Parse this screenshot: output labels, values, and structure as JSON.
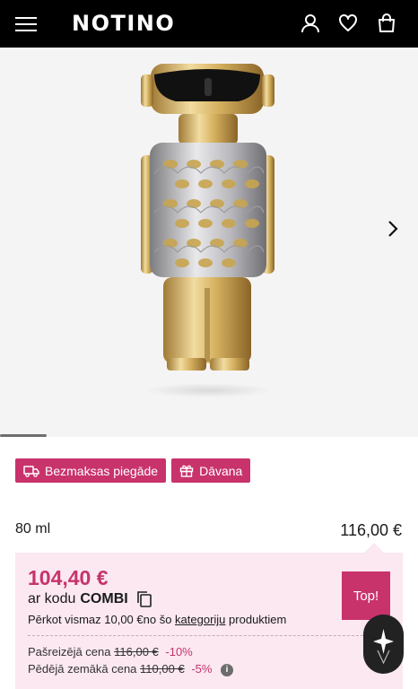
{
  "header": {
    "logo": "NOTINO",
    "icons": [
      "menu-icon",
      "user-icon",
      "heart-icon",
      "bag-icon"
    ]
  },
  "gallery": {
    "next_icon": "chevron-right-icon",
    "image": "perfume-bottle-robot"
  },
  "badges": [
    {
      "label": "Bezmaksas piegāde",
      "icon": "truck-icon"
    },
    {
      "label": "Dāvana",
      "icon": "gift-icon"
    }
  ],
  "variant": {
    "size": "80 ml",
    "price": "116,00 €"
  },
  "promo": {
    "price": "104,40 €",
    "code_prefix": "ar kodu",
    "code": "COMBI",
    "condition_before": "Pērkot vismaz 10,00 €no šo",
    "condition_link": "kategoriju",
    "condition_after": "produktiem",
    "top_label": "Top!",
    "current_label": "Pašreizējā cena",
    "current_old": "116,00 €",
    "current_pct": "-10%",
    "lowest_label": "Pēdējā zemākā cena",
    "lowest_old": "110,00 €",
    "lowest_pct": "-5%"
  },
  "colors": {
    "accent": "#c8336c",
    "promo_bg": "#fbe8f1",
    "header_bg": "#000000"
  }
}
